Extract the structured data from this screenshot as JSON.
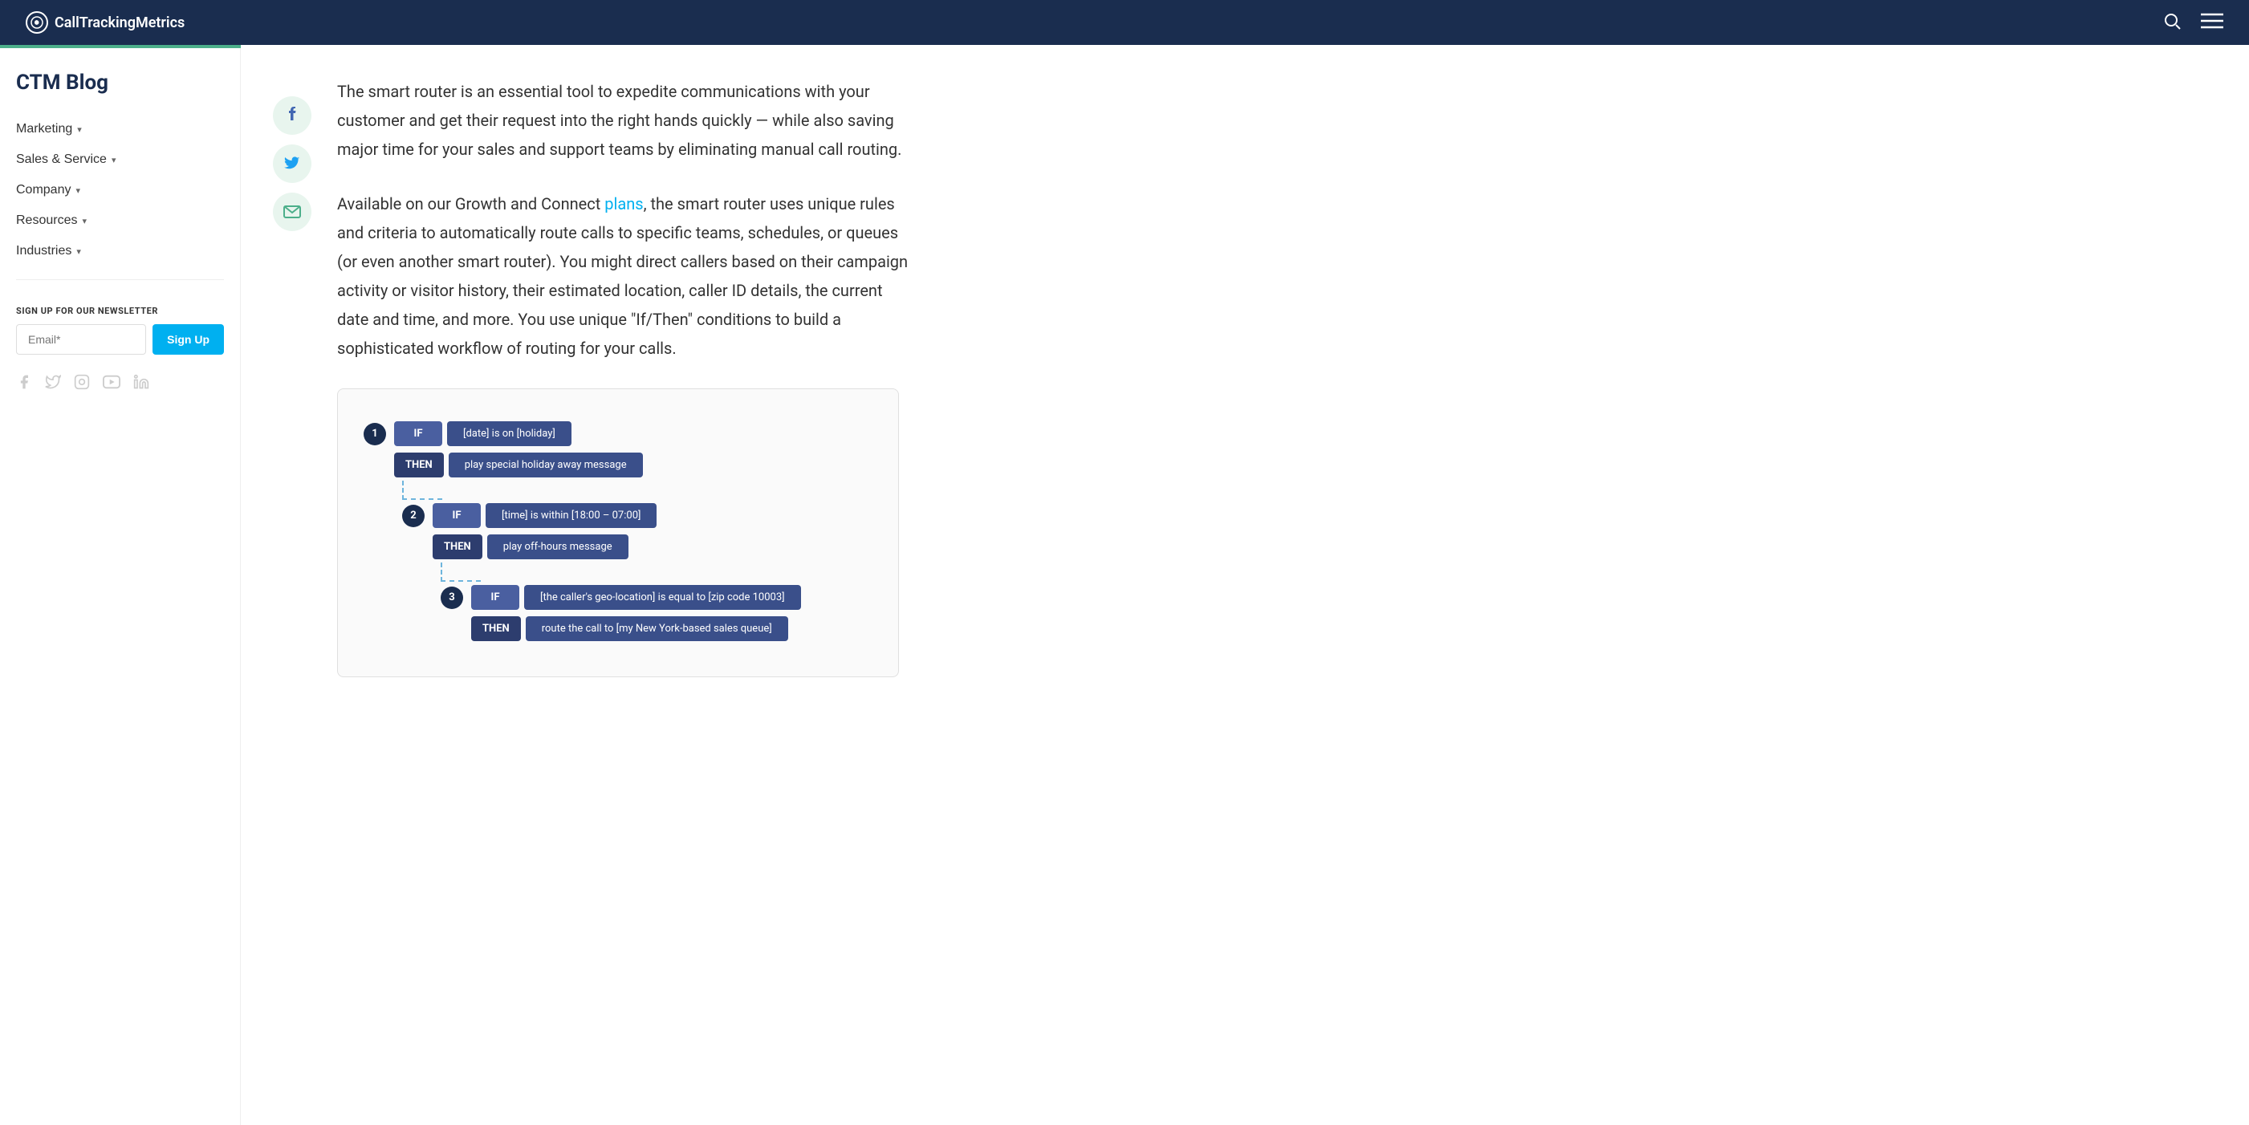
{
  "nav": {
    "logo_text": "CallTrackingMetrics",
    "search_label": "search",
    "menu_label": "menu"
  },
  "sidebar": {
    "blog_title": "CTM Blog",
    "nav_items": [
      {
        "label": "Marketing",
        "has_dropdown": true
      },
      {
        "label": "Sales & Service",
        "has_dropdown": true
      },
      {
        "label": "Company",
        "has_dropdown": true
      },
      {
        "label": "Resources",
        "has_dropdown": true
      },
      {
        "label": "Industries",
        "has_dropdown": true
      }
    ],
    "newsletter": {
      "label": "SIGN UP FOR OUR NEWSLETTER",
      "placeholder": "Email*",
      "button_label": "Sign Up"
    }
  },
  "social_share": {
    "facebook": "f",
    "twitter": "🐦",
    "email": "✉"
  },
  "article": {
    "paragraph1": "The smart router is an essential tool to expedite communications with your customer and get their request into the right hands quickly — while also saving major time for your sales and support teams by eliminating manual call routing.",
    "paragraph2_before_link": "Available on our Growth and Connect ",
    "paragraph2_link": "plans",
    "paragraph2_after_link": ", the smart router uses unique rules and criteria to automatically route calls to specific teams, schedules, or queues (or even another smart router). You might direct callers based on their campaign activity or visitor history, their estimated location, caller ID details, the current date and time, and more. You use unique \"If/Then\" conditions to build a sophisticated workflow of routing for your calls."
  },
  "diagram": {
    "rows": [
      {
        "step": "1",
        "indent": 0,
        "rules": [
          {
            "type": "IF",
            "content": "[date] is on [holiday]"
          },
          {
            "type": "THEN",
            "content": "play special holiday away message"
          }
        ]
      },
      {
        "step": "2",
        "indent": 1,
        "rules": [
          {
            "type": "IF",
            "content": "[time] is within [18:00 – 07:00]"
          },
          {
            "type": "THEN",
            "content": "play off-hours message"
          }
        ]
      },
      {
        "step": "3",
        "indent": 2,
        "rules": [
          {
            "type": "IF",
            "content": "[the caller's geo-location] is equal to [zip code 10003]"
          },
          {
            "type": "THEN",
            "content": "route the call to [my New York-based sales queue]"
          }
        ]
      }
    ]
  }
}
